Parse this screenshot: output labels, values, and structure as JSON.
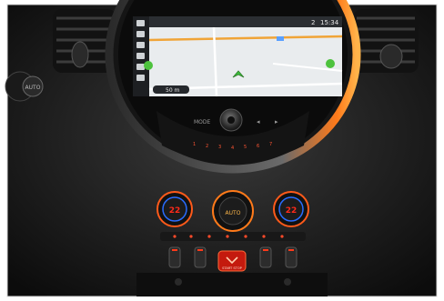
{
  "screen": {
    "status_temp": "2",
    "status_time": "15:34",
    "scale": "50 m",
    "colors": {
      "map_bg": "#e9ecee",
      "route": "#f0a437",
      "accent_green": "#4dc23d",
      "ring_orange": "#ff7a1a"
    }
  },
  "radio_panel": {
    "mode_label": "MODE",
    "presets": [
      "1",
      "2",
      "3",
      "4",
      "5",
      "6",
      "7"
    ]
  },
  "climate": {
    "left_temp": "22",
    "center_label": "AUTO",
    "right_temp": "22",
    "colors": {
      "display_red": "#ff2a1a",
      "display_blue": "#2a6cff"
    }
  },
  "toggle_row": {
    "start_label": "START STOP"
  },
  "vehicle_badge": "AUTO"
}
